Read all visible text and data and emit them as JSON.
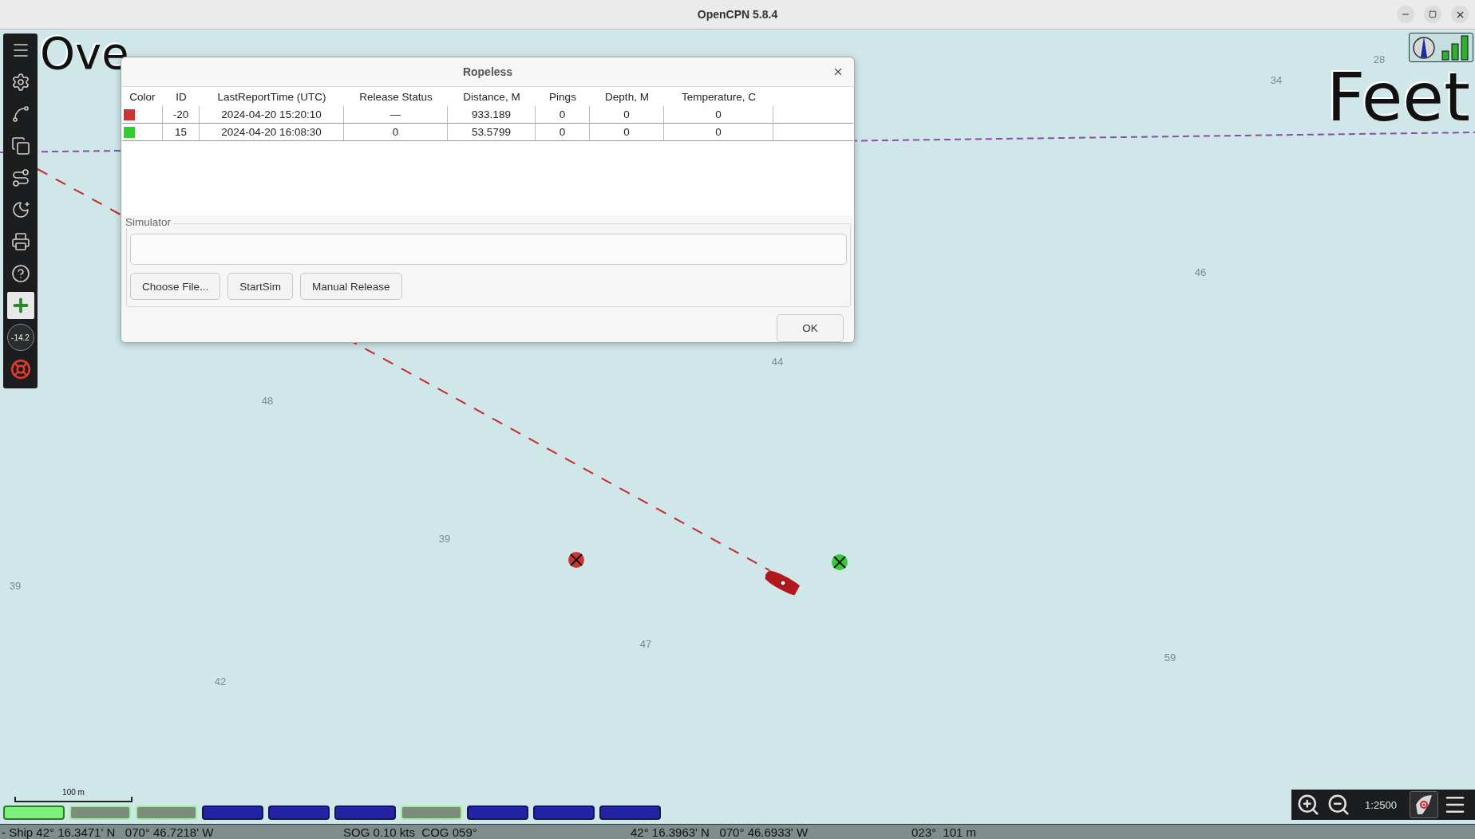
{
  "window": {
    "title": "OpenCPN 5.8.4"
  },
  "toolbar": {
    "compass_reading": "-14.2"
  },
  "chart": {
    "overlay_left": "Ove",
    "overlay_right": "Feet",
    "soundings": [
      "28",
      "34",
      "46",
      "44",
      "48",
      "39",
      "39",
      "47",
      "42",
      "59"
    ],
    "scale_label": "100 m",
    "scale": "1:2500"
  },
  "chart_bar": [
    {
      "kind": "current"
    },
    {
      "kind": "vector"
    },
    {
      "kind": "vector"
    },
    {
      "kind": "raster"
    },
    {
      "kind": "raster"
    },
    {
      "kind": "raster"
    },
    {
      "kind": "vector"
    },
    {
      "kind": "raster"
    },
    {
      "kind": "raster"
    },
    {
      "kind": "raster"
    }
  ],
  "dialog": {
    "title": "Ropeless",
    "columns": [
      "Color",
      "ID",
      "LastReportTime (UTC)",
      "Release Status",
      "Distance, M",
      "Pings",
      "Depth, M",
      "Temperature, C"
    ],
    "rows": [
      {
        "color": "#cc3333",
        "cells": [
          "",
          "-20",
          "2024-04-20 15:20:10",
          "—",
          "933.189",
          "0",
          "0",
          "0"
        ]
      },
      {
        "color": "#33cc33",
        "cells": [
          "",
          "15",
          "2024-04-20 16:08:30",
          "0",
          "53.5799",
          "0",
          "0",
          "0"
        ]
      }
    ],
    "group_label": "Simulator",
    "buttons": [
      "Choose File...",
      "StartSim",
      "Manual Release"
    ],
    "ok": "OK"
  },
  "status_bar": [
    "- Ship 42° 16.3471' N   070° 46.7218' W",
    "SOG 0.10 kts  COG 059°",
    "42° 16.3963' N   070° 46.6933' W",
    "023°  101 m"
  ]
}
